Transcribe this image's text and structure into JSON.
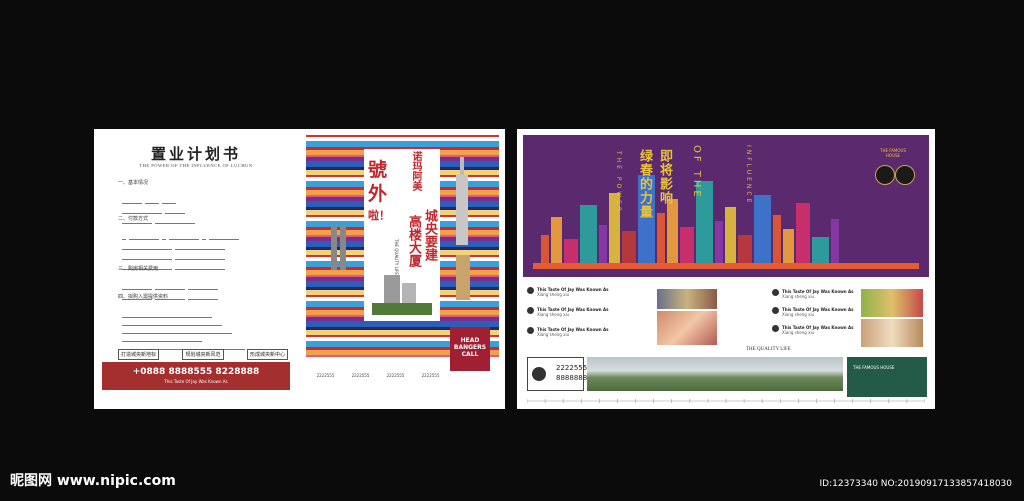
{
  "form": {
    "title": "置业计划书",
    "subtitle": "THE POWER OF THE INFLUENCE OF LUCHUN",
    "sections": [
      "一、基本情况",
      "二、付款方式",
      "三、购房相关费用",
      "四、拟购入需提供资料"
    ],
    "tags": [
      "打造城央新地标",
      "规划城央新风范",
      "形成城央新中心"
    ],
    "phone": "+0888 8888555 8228888",
    "phone_tagline": "This Taste Of Jay Was Known As"
  },
  "poster": {
    "hao": "號",
    "wai": "外",
    "la": "啦！",
    "name": "诺玛阿美",
    "line1": "城央要建",
    "line2": "高楼大厦",
    "quality": "THE QUALITY LIFE",
    "badge": "HEAD BANGERS CALL",
    "footer": [
      "2222555",
      "2222555",
      "2222555",
      "2222555"
    ]
  },
  "brochure": {
    "slogan1": "即将影响",
    "slogan2": "绿春的力量",
    "vert_en1": "THE POWER",
    "vert_en2": "OF THE",
    "vert_en3": "INFLUENCE",
    "famous": "THE FAMOUS HOUSE",
    "feature_title": "This Taste Of Jay Was Known As",
    "feature_sub": "Xiang sheng xiu",
    "quality_life": "THE QUALITY LIFE",
    "num1": "2222555",
    "num2": "8888888",
    "famous_house": "THE FAMOUS HOUSE"
  },
  "watermark": {
    "site": "昵图网 www.nipic.com",
    "id": "ID:12373340 NO:20190917133857418030"
  },
  "colors": {
    "background": "#0b0b0b",
    "red": "#c0282e",
    "purple": "#5b2a6e",
    "gold": "#e8c23a",
    "green": "#245a48"
  }
}
